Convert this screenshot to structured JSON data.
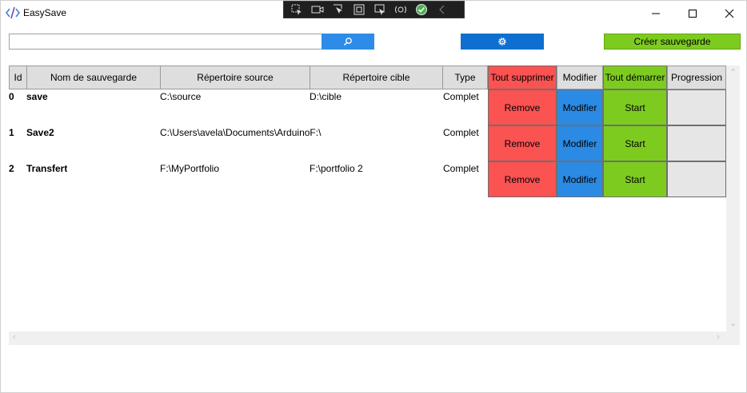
{
  "window": {
    "title": "EasySave"
  },
  "debug_toolbar": {
    "icons": [
      "select-element-icon",
      "video-icon",
      "pointer-icon",
      "frame-icon",
      "inspect-icon",
      "hot-reload-icon",
      "check-icon",
      "collapse-icon"
    ]
  },
  "toolbar": {
    "search_value": "",
    "create_label": "Créer sauvegarde"
  },
  "table": {
    "headers": {
      "id": "Id",
      "name": "Nom de sauvegarde",
      "source": "Répertoire source",
      "target": "Répertoire cible",
      "type": "Type",
      "delete_all": "Tout supprimer",
      "modify": "Modifier",
      "start_all": "Tout démarrer",
      "progress": "Progression"
    },
    "rows": [
      {
        "id": "0",
        "name": "save",
        "source": "C:\\source",
        "target": "D:\\cible",
        "type": "Complet",
        "remove": "Remove",
        "modify": "Modifier",
        "start": "Start"
      },
      {
        "id": "1",
        "name": "Save2",
        "source": "C:\\Users\\avela\\Documents\\ArduinoF:\\",
        "target": "",
        "type": "Complet",
        "remove": "Remove",
        "modify": "Modifier",
        "start": "Start"
      },
      {
        "id": "2",
        "name": "Transfert",
        "source": "F:\\MyPortfolio",
        "target": "F:\\portfolio 2",
        "type": "Complet",
        "remove": "Remove",
        "modify": "Modifier",
        "start": "Start"
      }
    ]
  },
  "colors": {
    "remove": "#fb5252",
    "modify": "#2b8ae3",
    "start": "#7ecb20",
    "search_button": "#2d8ce8",
    "settings_button": "#0e6fd0"
  }
}
